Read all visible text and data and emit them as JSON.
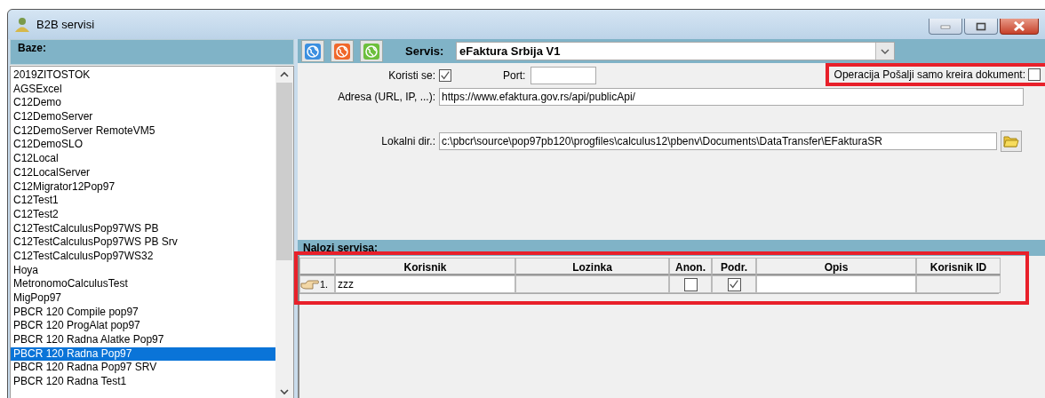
{
  "window": {
    "title": "B2B servisi"
  },
  "bases": {
    "header": "Baze:",
    "items": [
      {
        "label": "2019ZITOSTOK",
        "selected": false
      },
      {
        "label": "AGSExcel",
        "selected": false
      },
      {
        "label": "C12Demo",
        "selected": false
      },
      {
        "label": "C12DemoServer",
        "selected": false
      },
      {
        "label": "C12DemoServer RemoteVM5",
        "selected": false
      },
      {
        "label": "C12DemoSLO",
        "selected": false
      },
      {
        "label": "C12Local",
        "selected": false
      },
      {
        "label": "C12LocalServer",
        "selected": false
      },
      {
        "label": "C12Migrator12Pop97",
        "selected": false
      },
      {
        "label": "C12Test1",
        "selected": false
      },
      {
        "label": "C12Test2",
        "selected": false
      },
      {
        "label": "C12TestCalculusPop97WS PB",
        "selected": false
      },
      {
        "label": "C12TestCalculusPop97WS PB Srv",
        "selected": false
      },
      {
        "label": "C12TestCalculusPop97WS32",
        "selected": false
      },
      {
        "label": "Hoya",
        "selected": false
      },
      {
        "label": "MetronomoCalculusTest",
        "selected": false
      },
      {
        "label": "MigPop97",
        "selected": false
      },
      {
        "label": "PBCR 120 Compile pop97",
        "selected": false
      },
      {
        "label": "PBCR 120 ProgAlat pop97",
        "selected": false
      },
      {
        "label": "PBCR 120 Radna Alatke Pop97",
        "selected": false
      },
      {
        "label": "PBCR 120 Radna Pop97",
        "selected": true
      },
      {
        "label": "PBCR 120 Radna Pop97 SRV",
        "selected": false
      },
      {
        "label": "PBCR 120 Radna Test1",
        "selected": false
      }
    ]
  },
  "toolbar": {
    "buttons": [
      {
        "color": "#3b8fe0"
      },
      {
        "color": "#f0672a"
      },
      {
        "color": "#6cbf3c"
      }
    ]
  },
  "service": {
    "label": "Servis:",
    "value": "eFaktura Srbija V1"
  },
  "in_use": {
    "label": "Koristi se:",
    "checked": true
  },
  "port": {
    "label": "Port:"
  },
  "create_only": {
    "label": "Operacija Pošalji samo kreira dokument:",
    "checked": false,
    "highlighted": true
  },
  "address": {
    "label": "Adresa (URL, IP, ...):",
    "value": "https://www.efaktura.gov.rs/api/publicApi/"
  },
  "local_dir": {
    "label": "Lokalni dir.:",
    "value": "c:\\pbcr\\source\\pop97pb120\\progfiles\\calculus12\\pbenv\\Documents\\DataTransfer\\EFakturaSR"
  },
  "orders": {
    "header": "Nalozi servisa:",
    "highlighted": true,
    "columns": [
      "Korisnik",
      "Lozinka",
      "Anon.",
      "Podr.",
      "Opis",
      "Korisnik ID"
    ],
    "rows": [
      {
        "number": "1.",
        "user": "zzz",
        "anon": false,
        "supported": true
      }
    ]
  }
}
